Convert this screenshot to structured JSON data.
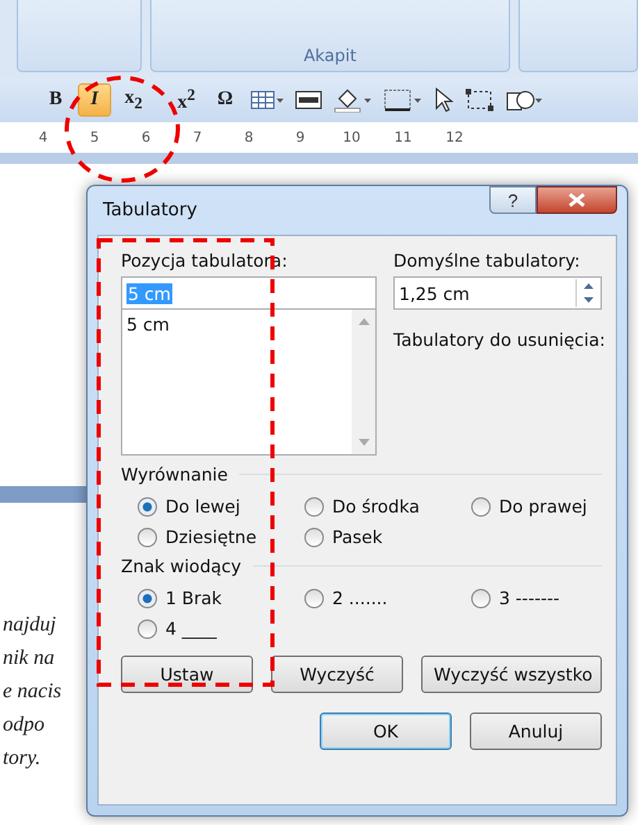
{
  "ribbon": {
    "group_label": "Akapit"
  },
  "toolbar": [
    {
      "label": "B",
      "selected": false
    },
    {
      "label": "I",
      "selected": true
    },
    {
      "label": "x$_{2}$",
      "selected": false
    },
    {
      "label": "x$^{2}$",
      "selected": false
    },
    {
      "label": "Ω",
      "selected": false
    }
  ],
  "ruler": {
    "marks": [
      "4",
      "5",
      "6",
      "7",
      "8",
      "9",
      "10",
      "11",
      "12"
    ]
  },
  "document": {
    "lines": [
      "najduj",
      "nik na",
      "e nacis",
      "odpo",
      "tory."
    ]
  },
  "dialog": {
    "title": "Tabulatory",
    "help": "?",
    "tab_position": {
      "label": "Pozycja tabulatora:",
      "value": "5 cm",
      "list": [
        "5 cm"
      ]
    },
    "default_tabs": {
      "label": "Domyślne tabulatory:",
      "value": "1,25 cm"
    },
    "to_clear": {
      "label": "Tabulatory do usunięcia:"
    },
    "alignment": {
      "label": "Wyrównanie",
      "options": [
        {
          "label": "Do lewej",
          "selected": true
        },
        {
          "label": "Do środka",
          "selected": false
        },
        {
          "label": "Do prawej",
          "selected": false
        },
        {
          "label": "Dziesiętne",
          "selected": false
        },
        {
          "label": "Pasek",
          "selected": false
        }
      ]
    },
    "leader": {
      "label": "Znak wiodący",
      "options": [
        {
          "label": "1 Brak",
          "selected": true
        },
        {
          "label": "2 .......",
          "selected": false
        },
        {
          "label": "3 -------",
          "selected": false
        },
        {
          "label": "4 ____",
          "selected": false
        }
      ]
    },
    "buttons": [
      "Ustaw",
      "Wyczyść",
      "Wyczyść wszystko"
    ],
    "footer_buttons": [
      {
        "label": "OK",
        "default": true
      },
      {
        "label": "Anuluj",
        "default": false
      }
    ]
  }
}
